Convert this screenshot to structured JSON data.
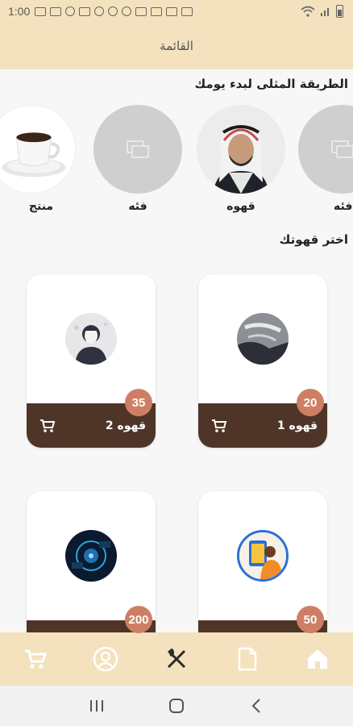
{
  "status_bar": {
    "time": "1:00"
  },
  "app_bar": {
    "title": "القائمة"
  },
  "section_categories": {
    "title": "الطريقة المثلى لبدء يومك"
  },
  "categories": [
    {
      "label": "فئه",
      "icon": "image-placeholder-icon"
    },
    {
      "label": "قهوه",
      "icon": "person-photo"
    },
    {
      "label": "فئه",
      "icon": "image-placeholder-icon"
    },
    {
      "label": "منتج",
      "icon": "coffee-cup-photo"
    }
  ],
  "section_products": {
    "title": "اختر قهوتك"
  },
  "products": [
    {
      "name": "قهوه 1",
      "price": "20",
      "image": "dark-photo"
    },
    {
      "name": "قهوه 2",
      "price": "35",
      "image": "avatar-photo"
    },
    {
      "name": "",
      "price": "50",
      "image": "illustration-photo"
    },
    {
      "name": "",
      "price": "200",
      "image": "tech-photo"
    }
  ],
  "bottom_nav": [
    {
      "name": "home-icon"
    },
    {
      "name": "document-icon"
    },
    {
      "name": "restaurant-icon"
    },
    {
      "name": "profile-icon"
    },
    {
      "name": "cart-icon"
    }
  ],
  "colors": {
    "accent_bar": "#f3e2bd",
    "card_bottom": "#4e3528",
    "badge": "#cf7e66"
  }
}
